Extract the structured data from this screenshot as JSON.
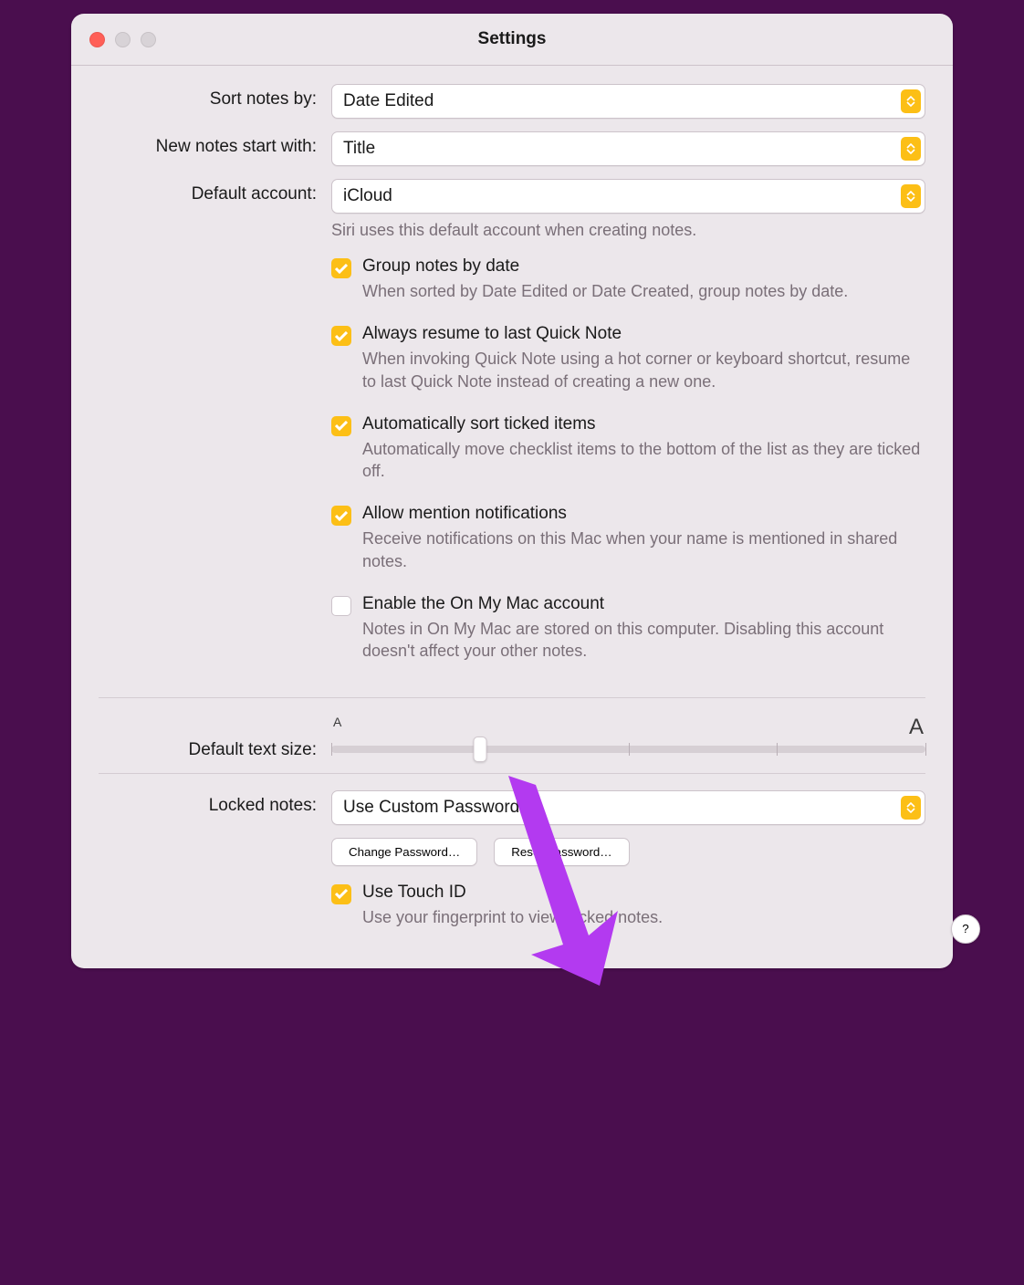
{
  "window": {
    "title": "Settings"
  },
  "form": {
    "sort_notes_by": {
      "label": "Sort notes by:",
      "value": "Date Edited"
    },
    "new_notes_start_with": {
      "label": "New notes start with:",
      "value": "Title"
    },
    "default_account": {
      "label": "Default account:",
      "value": "iCloud",
      "hint": "Siri uses this default account when creating notes."
    },
    "group_by_date": {
      "label": "Group notes by date",
      "checked": true,
      "desc": "When sorted by Date Edited or Date Created, group notes by date."
    },
    "resume_quick_note": {
      "label": "Always resume to last Quick Note",
      "checked": true,
      "desc": "When invoking Quick Note using a hot corner or keyboard shortcut, resume to last Quick Note instead of creating a new one."
    },
    "auto_sort_ticked": {
      "label": "Automatically sort ticked items",
      "checked": true,
      "desc": "Automatically move checklist items to the bottom of the list as they are ticked off."
    },
    "mention_notifications": {
      "label": "Allow mention notifications",
      "checked": true,
      "desc": "Receive notifications on this Mac when your name is mentioned in shared notes."
    },
    "on_my_mac": {
      "label": "Enable the On My Mac account",
      "checked": false,
      "desc": "Notes in On My Mac are stored on this computer. Disabling this account doesn't affect your other notes."
    },
    "text_size": {
      "label": "Default text size:",
      "min_glyph": "A",
      "max_glyph": "A",
      "value": 1,
      "ticks": 5
    },
    "locked_notes": {
      "label": "Locked notes:",
      "value": "Use Custom Password",
      "change_btn": "Change Password…",
      "reset_btn": "Reset Password…"
    },
    "touch_id": {
      "label": "Use Touch ID",
      "checked": true,
      "desc": "Use your fingerprint to view locked notes."
    }
  },
  "help_btn": "?",
  "annotation": {
    "arrow_color": "#b33af0"
  }
}
